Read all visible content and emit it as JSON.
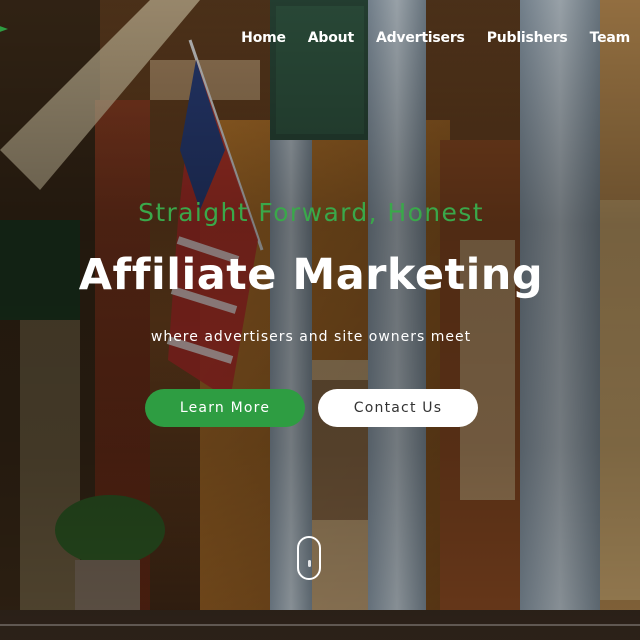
{
  "nav": {
    "items": [
      {
        "label": "Home"
      },
      {
        "label": "About"
      },
      {
        "label": "Advertisers"
      },
      {
        "label": "Publishers"
      },
      {
        "label": "Team"
      }
    ]
  },
  "hero": {
    "tagline": "Straight Forward, Honest",
    "headline": "Affiliate Marketing",
    "subtext": "where advertisers and site owners meet",
    "buttons": {
      "learn_more": "Learn More",
      "contact_us": "Contact Us"
    }
  },
  "colors": {
    "accent_green": "#2e9d42",
    "tagline_green": "#3aa84a",
    "white": "#ffffff"
  },
  "icons": {
    "scroll": "mouse-scroll-icon",
    "logo": "logo-mark-icon"
  }
}
